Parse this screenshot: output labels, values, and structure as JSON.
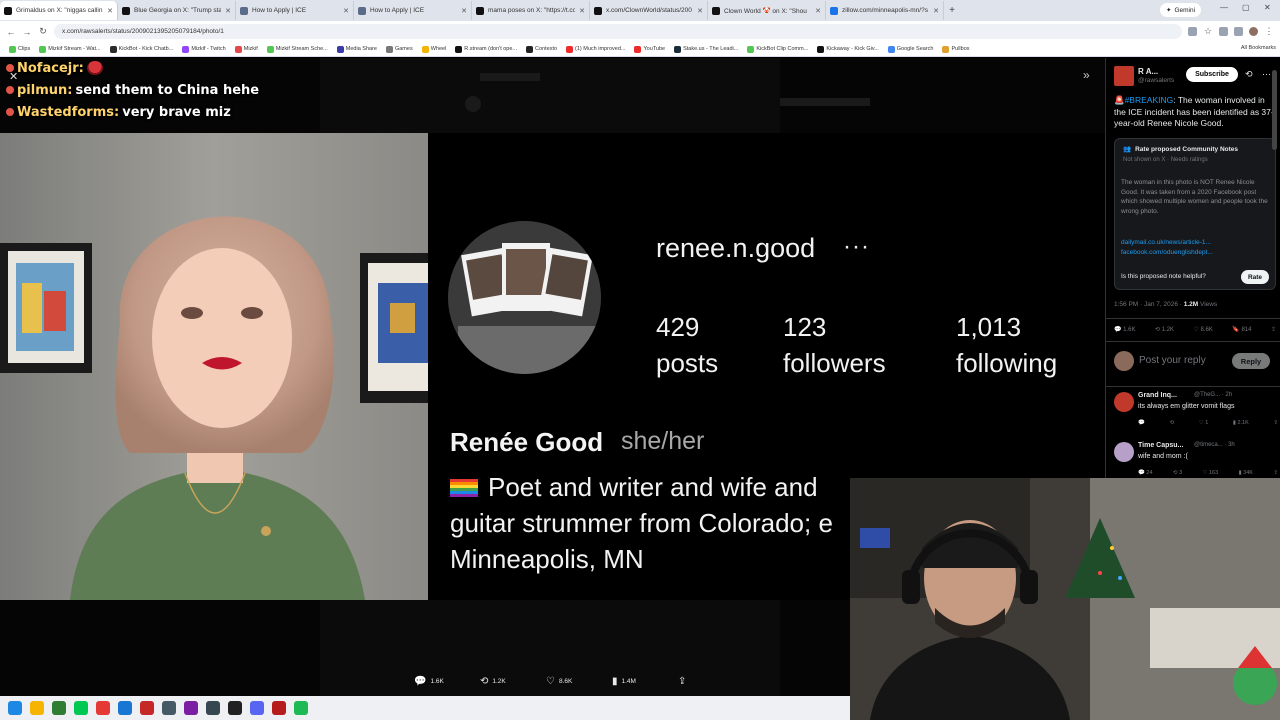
{
  "browser": {
    "tabs": [
      {
        "title": "Grimaldus on X: \"niggas callin",
        "color": "#111111",
        "active": true
      },
      {
        "title": "Blue Georgia on X: \"Trump sta",
        "color": "#111111"
      },
      {
        "title": "How to Apply | ICE",
        "color": "#5b6b8a"
      },
      {
        "title": "How to Apply | ICE",
        "color": "#5b6b8a"
      },
      {
        "title": "mama poses on X: \"https://t.co",
        "color": "#111111"
      },
      {
        "title": "x.com/ClownWorld/status/200",
        "color": "#111111"
      },
      {
        "title": "Clown World 🤡 on X: \"Shou",
        "color": "#111111"
      },
      {
        "title": "zillow.com/minneapolis-mn/?s",
        "color": "#1a73e8"
      }
    ],
    "new_tab": "+",
    "gemini_label": "Gemini",
    "url": "x.com/rawsalerts/status/2009021395205079184/photo/1",
    "bookmarks": [
      {
        "label": "Clips",
        "color": "#53c653"
      },
      {
        "label": "Mizkif Stream - Wat...",
        "color": "#53c653"
      },
      {
        "label": "KickBot - Kick Chatb...",
        "color": "#2b2b2b"
      },
      {
        "label": "Mizkif - Twitch",
        "color": "#9146ff"
      },
      {
        "label": "Mizkif",
        "color": "#e54848"
      },
      {
        "label": "Mizkif Stream Sche...",
        "color": "#53c653"
      },
      {
        "label": "Media Share",
        "color": "#3a3aa8"
      },
      {
        "label": "Games",
        "color": "#777777"
      },
      {
        "label": "Wheel",
        "color": "#f2b400"
      },
      {
        "label": "R.stream (don't ope...",
        "color": "#111111"
      },
      {
        "label": "Contexto",
        "color": "#222222"
      },
      {
        "label": "(1) Much improved...",
        "color": "#ee2a2a"
      },
      {
        "label": "YouTube",
        "color": "#ee2a2a"
      },
      {
        "label": "Stake.us - The Leadi...",
        "color": "#1a2c38"
      },
      {
        "label": "KickBot Clip Comm...",
        "color": "#53c653"
      },
      {
        "label": "Kickaway - Kick Giv...",
        "color": "#111111"
      },
      {
        "label": "Google Search",
        "color": "#4285f4"
      },
      {
        "label": "Pullbox",
        "color": "#e0a030"
      }
    ],
    "all_bookmarks": "All Bookmarks"
  },
  "chat": [
    {
      "user": "Nofacejr:",
      "message": ""
    },
    {
      "user": "pilmun:",
      "message": "send them to China hehe"
    },
    {
      "user": "Wastedforms:",
      "message": "very brave miz"
    }
  ],
  "instagram": {
    "username": "renee.n.good",
    "more": "···",
    "stats": [
      {
        "value": "429",
        "label": "posts"
      },
      {
        "value": "123",
        "label": "followers"
      },
      {
        "value": "1,013",
        "label": "following"
      }
    ],
    "name": "Renée Good",
    "pronouns": "she/her",
    "bio_lines": [
      "Poet and writer and wife and",
      "guitar strummer from Colorado; e",
      "Minneapolis, MN"
    ]
  },
  "tweet_actions": [
    {
      "icon": "reply-icon",
      "glyph": "💬",
      "count": "1.6K"
    },
    {
      "icon": "retweet-icon",
      "glyph": "⟲",
      "count": "1.2K"
    },
    {
      "icon": "like-icon",
      "glyph": "♡",
      "count": "8.6K"
    },
    {
      "icon": "views-icon",
      "glyph": "▮",
      "count": "1.4M"
    },
    {
      "icon": "share-icon",
      "glyph": "⇪",
      "count": ""
    }
  ],
  "sidebar": {
    "account_name": "R A...",
    "account_handle": "@rawsalerts",
    "subscribe": "Subscribe",
    "tweet_hashtag": "🚨#BREAKING",
    "tweet_body": ": The woman involved in the ICE incident has been identified as 37-year-old Renee Nicole Good.",
    "community_note": {
      "title": "Rate proposed Community Notes",
      "subtitle": "Not shown on X · Needs ratings",
      "body": "The woman in this photo is NOT Renee Nicole Good. It was taken from a 2020 Facebook post which showed multiple women and people took the wrong photo.",
      "links": [
        "dailymail.co.uk/news/article-1...",
        "facebook.com/oduenglishdept..."
      ],
      "question": "Is this proposed note helpful?",
      "rate": "Rate"
    },
    "timestamp": "1:56 PM · Jan 7, 2026 · ",
    "views": "1.2M",
    "views_label": " Views",
    "engagement": [
      "1.6K",
      "1.2K",
      "8.6K",
      "814"
    ],
    "reply_placeholder": "Post your reply",
    "reply_button": "Reply",
    "replies": [
      {
        "name": "Grand Inq...",
        "meta": "@TheG... · 2h",
        "text": "its always em glitter vomit flags",
        "counts": [
          "",
          "",
          "1",
          "2.1K",
          ""
        ],
        "color": "#c0392b"
      },
      {
        "name": "Time Capsu...",
        "meta": "@timeca... · 3h",
        "text": "wife and mom :(",
        "counts": [
          "24",
          "3",
          "163",
          "34K",
          ""
        ],
        "color": "#b6a0c8"
      }
    ]
  },
  "taskbar": {
    "icons": [
      {
        "name": "windows-start-icon",
        "color": "#1e88e5"
      },
      {
        "name": "file-explorer-icon",
        "color": "#f4b400"
      },
      {
        "name": "app-icon",
        "color": "#2e7d32"
      },
      {
        "name": "green-app-icon",
        "color": "#00c853"
      },
      {
        "name": "chrome-icon",
        "color": "#e53935"
      },
      {
        "name": "edge-icon",
        "color": "#1976d2"
      },
      {
        "name": "red-app-icon",
        "color": "#c62828"
      },
      {
        "name": "obs-app-icon",
        "color": "#455a64"
      },
      {
        "name": "slack-icon",
        "color": "#7b1fa2"
      },
      {
        "name": "steam-icon",
        "color": "#37474f"
      },
      {
        "name": "dark-app-icon",
        "color": "#212121"
      },
      {
        "name": "discord-icon",
        "color": "#5865f2"
      },
      {
        "name": "game-icon",
        "color": "#b71c1c"
      },
      {
        "name": "spotify-icon",
        "color": "#1db954"
      }
    ]
  }
}
